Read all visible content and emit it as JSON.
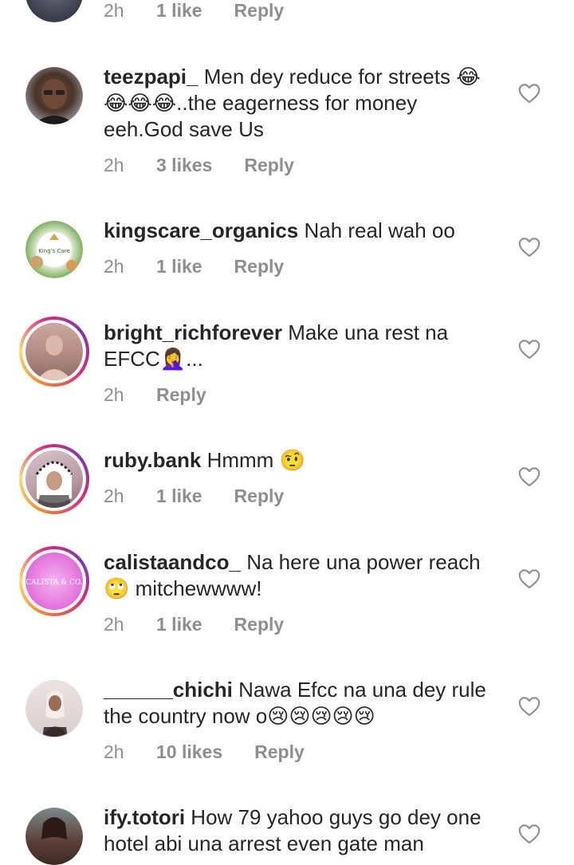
{
  "comments": [
    {
      "username": "",
      "text": "",
      "time": "2h",
      "likes": "1 like",
      "reply": "Reply"
    },
    {
      "username": "teezpapi_",
      "text": "Men dey reduce for streets 😂😂😂😂..the eagerness for money eeh.God save Us",
      "time": "2h",
      "likes": "3 likes",
      "reply": "Reply"
    },
    {
      "username": "kingscare_organics",
      "text": "Nah real wah oo",
      "time": "2h",
      "likes": "1 like",
      "reply": "Reply",
      "avatar_text": "King's Care"
    },
    {
      "username": "bright_richforever",
      "text": "Make una rest na EFCC🤦‍♀️...",
      "time": "2h",
      "likes": "",
      "reply": "Reply"
    },
    {
      "username": "ruby.bank",
      "text": "Hmmm 🤨",
      "time": "2h",
      "likes": "1 like",
      "reply": "Reply"
    },
    {
      "username": "calistaandco_",
      "text": "Na here una power reach 🙄 mitchewwww!",
      "time": "2h",
      "likes": "1 like",
      "reply": "Reply",
      "avatar_text": "CALISTA & CO."
    },
    {
      "username": "______chichi",
      "text": "Nawa Efcc na una dey rule the country now o😢😢😢😢😢",
      "time": "2h",
      "likes": "10 likes",
      "reply": "Reply"
    },
    {
      "username": "ify.totori",
      "text": "How 79 yahoo guys go dey one hotel abi una arrest even gate man",
      "time": "",
      "likes": "",
      "reply": ""
    }
  ],
  "icons": {
    "like": "heart-outline-icon"
  },
  "colors": {
    "text": "#262626",
    "meta": "#8e8e8e",
    "story_ring_start": "#f58529",
    "story_ring_end": "#dd2a7b"
  }
}
